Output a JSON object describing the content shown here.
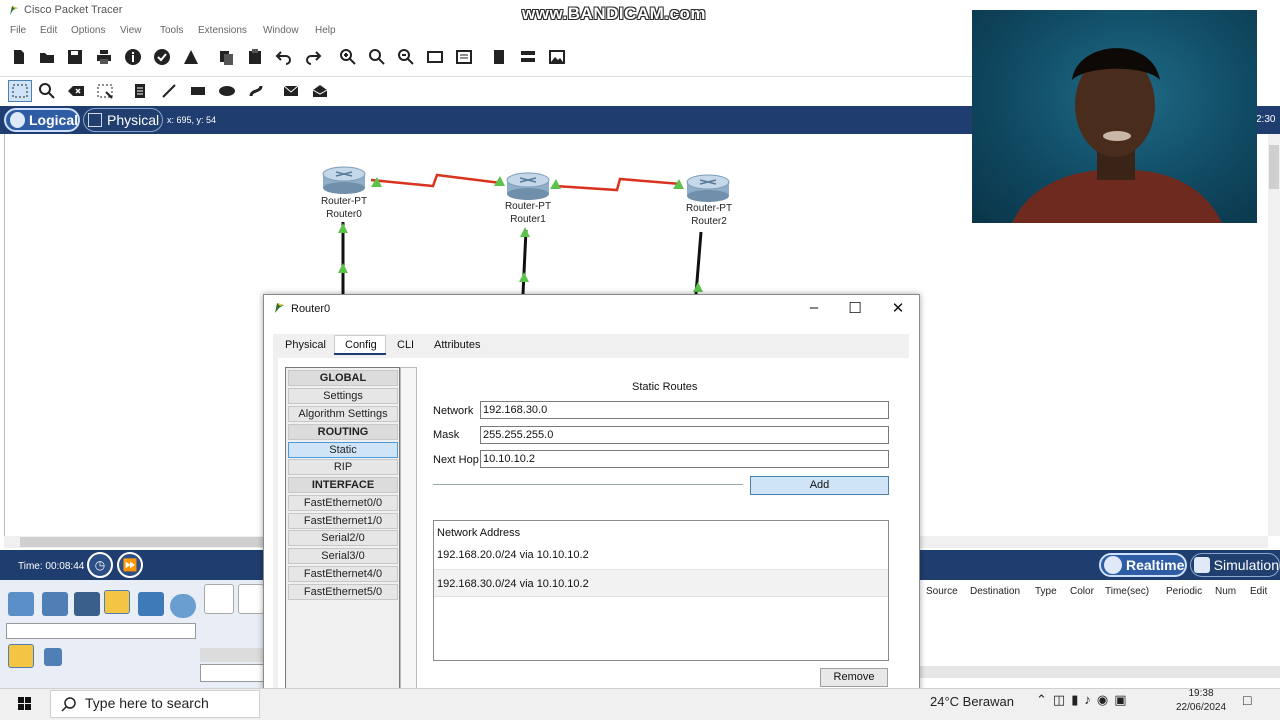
{
  "app": {
    "title": "Cisco Packet Tracer",
    "watermark": "www.BANDICAM.com"
  },
  "menu": [
    "File",
    "Edit",
    "Options",
    "View",
    "Tools",
    "Extensions",
    "Window",
    "Help"
  ],
  "mode_bar": {
    "logical_label": "Logical",
    "physical_label": "Physical",
    "coords": "x: 695, y: 54",
    "clock_fragment": "2:30"
  },
  "topology": {
    "routers": [
      {
        "model": "Router-PT",
        "name": "Router0"
      },
      {
        "model": "Router-PT",
        "name": "Router1"
      },
      {
        "model": "Router-PT",
        "name": "Router2"
      }
    ],
    "colors": {
      "serial_link": "#d9321f",
      "ethernet_link": "#111111",
      "link_light": "#5cc24b"
    }
  },
  "sim_bar": {
    "time_label": "Time: 00:08:44",
    "realtime_label": "Realtime",
    "simulation_label": "Simulation"
  },
  "event_list": {
    "columns": [
      "Source",
      "Destination",
      "Type",
      "Color",
      "Time(sec)",
      "Periodic",
      "Num",
      "Edit"
    ]
  },
  "dialog": {
    "title": "Router0",
    "tabs": [
      "Physical",
      "Config",
      "CLI",
      "Attributes"
    ],
    "active_tab": "Config",
    "nav": [
      {
        "label": "GLOBAL",
        "type": "header"
      },
      {
        "label": "Settings",
        "type": "item"
      },
      {
        "label": "Algorithm Settings",
        "type": "item"
      },
      {
        "label": "ROUTING",
        "type": "header"
      },
      {
        "label": "Static",
        "type": "selected"
      },
      {
        "label": "RIP",
        "type": "item"
      },
      {
        "label": "INTERFACE",
        "type": "header"
      },
      {
        "label": "FastEthernet0/0",
        "type": "item"
      },
      {
        "label": "FastEthernet1/0",
        "type": "item"
      },
      {
        "label": "Serial2/0",
        "type": "item"
      },
      {
        "label": "Serial3/0",
        "type": "item"
      },
      {
        "label": "FastEthernet4/0",
        "type": "item"
      },
      {
        "label": "FastEthernet5/0",
        "type": "item"
      }
    ],
    "static_routes": {
      "title": "Static Routes",
      "network_label": "Network",
      "network_value": "192.168.30.0",
      "mask_label": "Mask",
      "mask_value": "255.255.255.0",
      "nexthop_label": "Next Hop",
      "nexthop_value": "10.10.10.2",
      "add_label": "Add",
      "table_header": "Network Address",
      "routes": [
        "192.168.20.0/24 via 10.10.10.2",
        "192.168.30.0/24 via 10.10.10.2"
      ],
      "remove_label": "Remove"
    }
  },
  "taskbar": {
    "search_placeholder": "Type here to search",
    "weather": "24°C  Berawan",
    "time": "19:38",
    "date": "22/06/2024"
  }
}
